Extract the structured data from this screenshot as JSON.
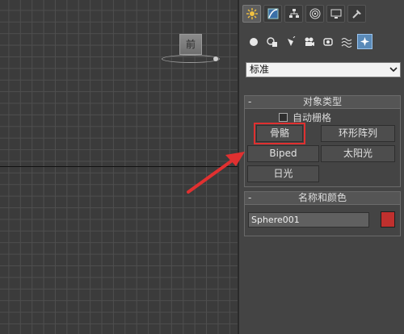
{
  "viewport": {
    "viewcube_label": "前"
  },
  "command_panel": {
    "tabs": [
      {
        "icon": "create-icon",
        "active": true
      },
      {
        "icon": "modify-icon",
        "active": false
      },
      {
        "icon": "hierarchy-icon",
        "active": false
      },
      {
        "icon": "motion-icon",
        "active": false
      },
      {
        "icon": "display-icon",
        "active": false
      },
      {
        "icon": "utilities-icon",
        "active": false
      }
    ],
    "categories": [
      {
        "icon": "geometry-icon"
      },
      {
        "icon": "shapes-icon"
      },
      {
        "icon": "lights-icon"
      },
      {
        "icon": "cameras-icon"
      },
      {
        "icon": "helpers-icon"
      },
      {
        "icon": "space-warps-icon"
      },
      {
        "icon": "systems-icon",
        "active": true
      }
    ],
    "dropdown": {
      "value": "标准"
    },
    "object_type": {
      "header": "对象类型",
      "collapse": "-",
      "autogrid_label": "自动栅格",
      "buttons": {
        "bones": "骨骼",
        "ring_array": "环形阵列",
        "biped": "Biped",
        "sunlight": "太阳光",
        "daylight": "日光"
      }
    },
    "name_color": {
      "header": "名称和颜色",
      "collapse": "-",
      "name_value": "Sphere001",
      "swatch_color": "#c0302e"
    }
  },
  "annotation": {
    "highlight_color": "#e03030",
    "arrow_color": "#e03030"
  }
}
